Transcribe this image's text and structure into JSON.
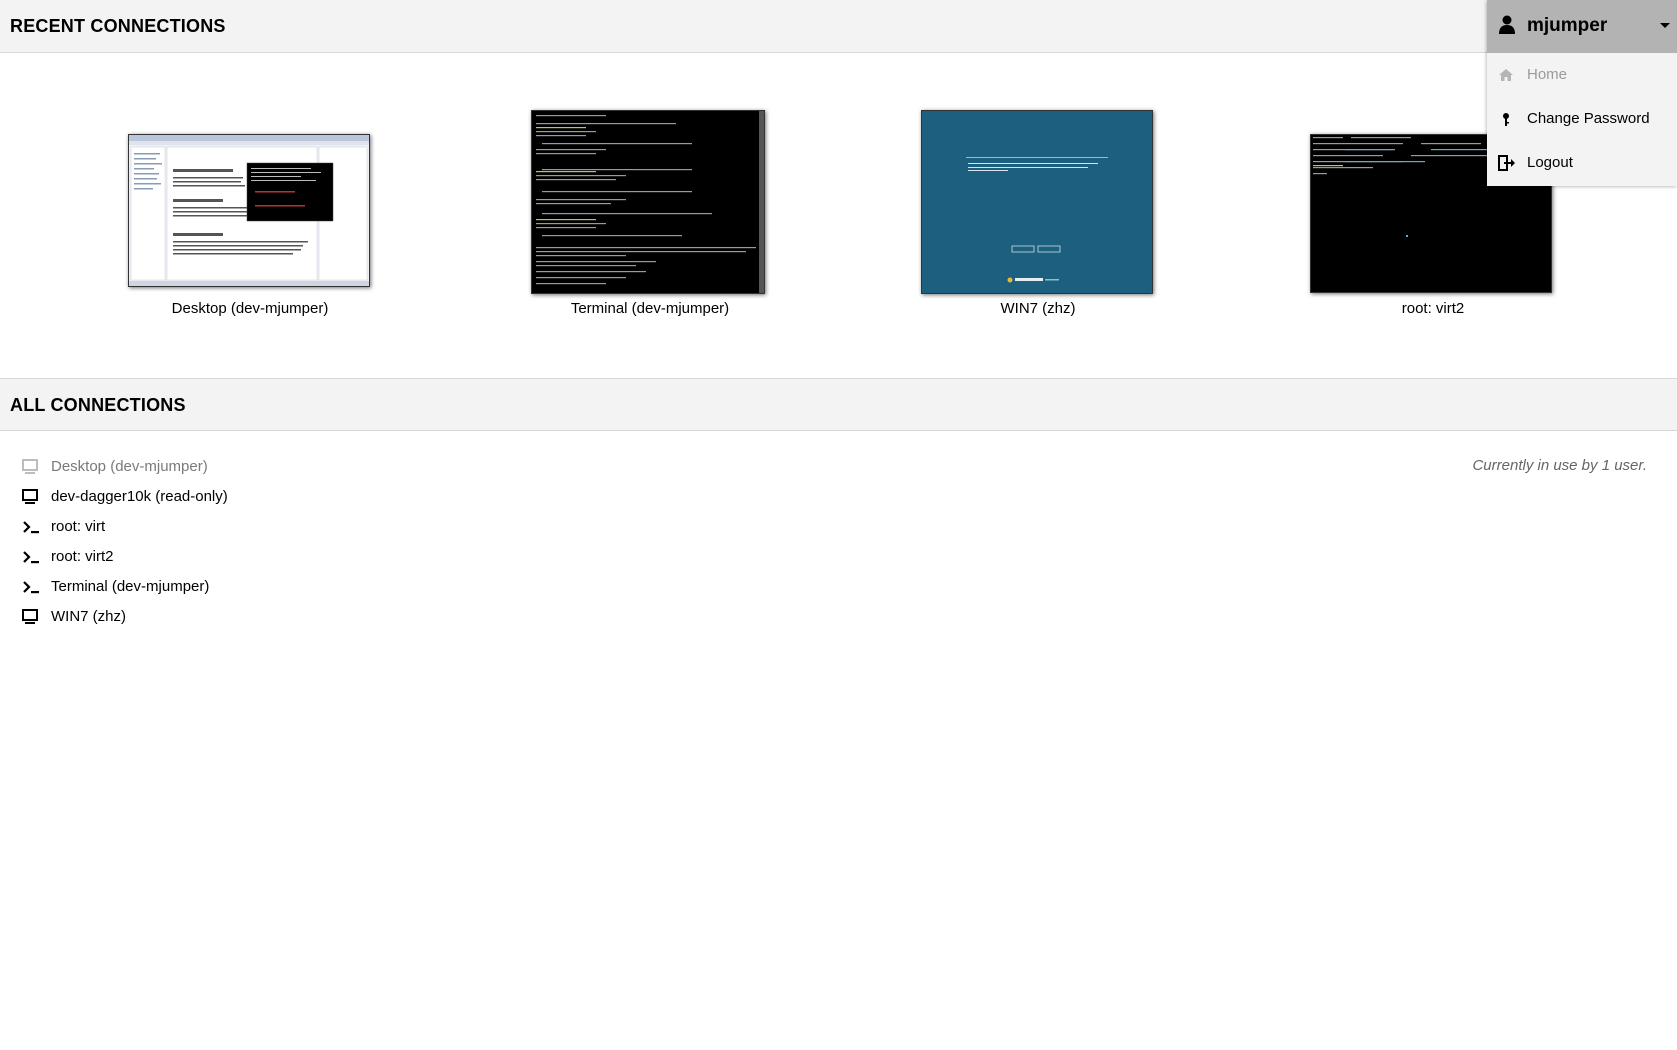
{
  "recent": {
    "title": "RECENT CONNECTIONS",
    "items": [
      {
        "label": "Desktop (dev-mjumper)",
        "thumb": "desktop-screenshot"
      },
      {
        "label": "Terminal (dev-mjumper)",
        "thumb": "terminal-screenshot"
      },
      {
        "label": "WIN7 (zhz)",
        "thumb": "windows7-login-screenshot"
      },
      {
        "label": "root: virt2",
        "thumb": "terminal-screenshot"
      }
    ]
  },
  "all": {
    "title": "ALL CONNECTIONS",
    "in_use_text": "Currently in use by 1 user.",
    "items": [
      {
        "label": "Desktop (dev-mjumper)",
        "icon": "monitor-icon",
        "active": false
      },
      {
        "label": "dev-dagger10k (read-only)",
        "icon": "monitor-icon",
        "active": true
      },
      {
        "label": "root: virt",
        "icon": "terminal-icon",
        "active": true
      },
      {
        "label": "root: virt2",
        "icon": "terminal-icon",
        "active": true
      },
      {
        "label": "Terminal (dev-mjumper)",
        "icon": "terminal-icon",
        "active": true
      },
      {
        "label": "WIN7 (zhz)",
        "icon": "monitor-icon",
        "active": true
      }
    ]
  },
  "user_menu": {
    "username": "mjumper",
    "items": [
      {
        "label": "Home",
        "icon": "home-icon",
        "disabled": true
      },
      {
        "label": "Change Password",
        "icon": "key-icon",
        "disabled": false
      },
      {
        "label": "Logout",
        "icon": "logout-icon",
        "disabled": false
      }
    ]
  },
  "colors": {
    "header_bg": "#f3f3f3",
    "user_bar_bg": "#b3b3b3",
    "win7_blue": "#1c5f7e"
  }
}
